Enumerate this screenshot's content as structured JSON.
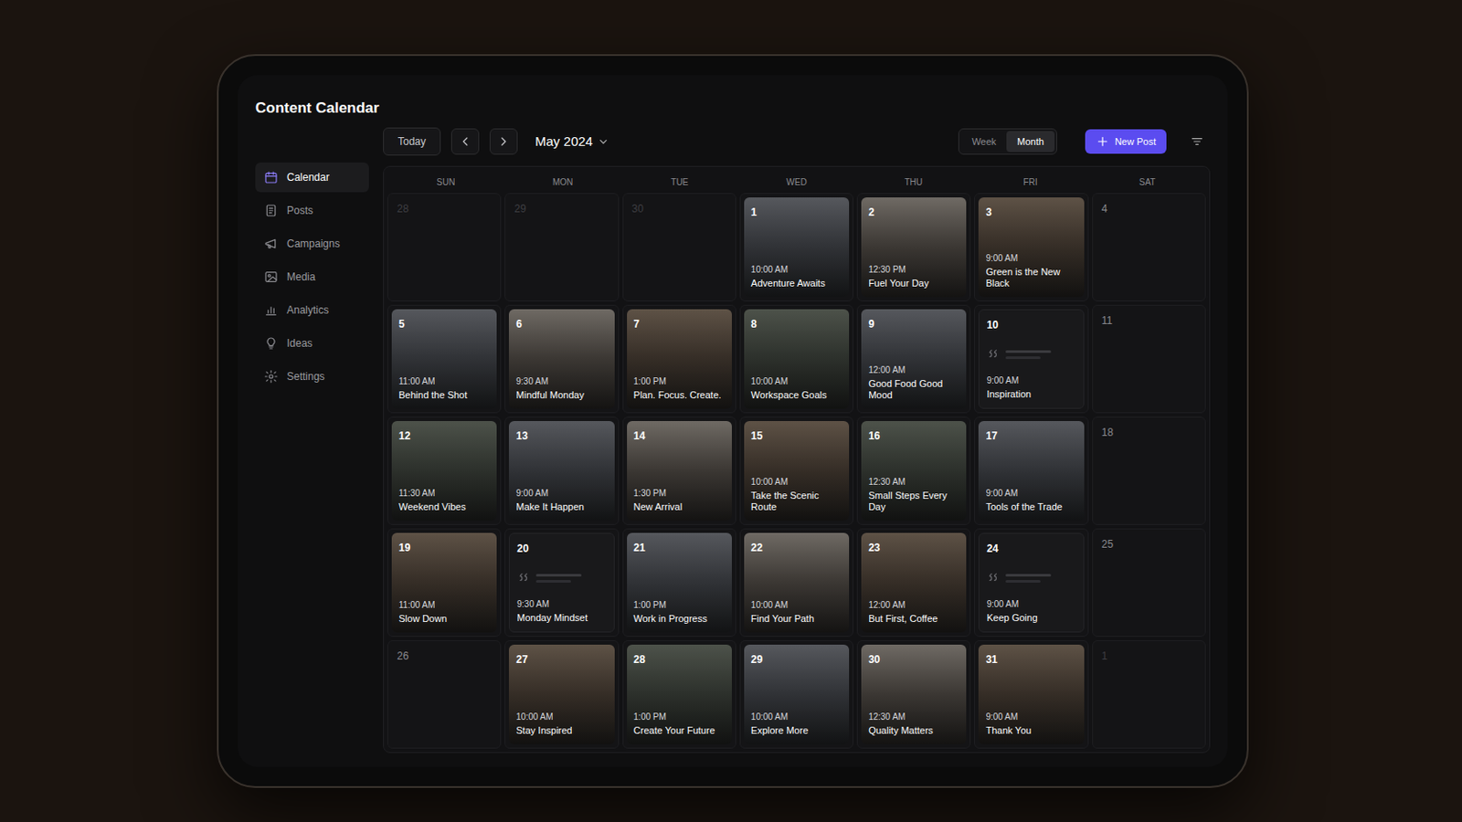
{
  "app": {
    "title": "Content Calendar"
  },
  "sidebar": {
    "items": [
      {
        "label": "Calendar",
        "selected": true
      },
      {
        "label": "Posts",
        "selected": false
      },
      {
        "label": "Campaigns",
        "selected": false
      },
      {
        "label": "Media",
        "selected": false
      },
      {
        "label": "Analytics",
        "selected": false
      },
      {
        "label": "Ideas",
        "selected": false
      },
      {
        "label": "Settings",
        "selected": false
      }
    ]
  },
  "toolbar": {
    "today": "Today",
    "month": "May 2024",
    "views": [
      {
        "label": "Week",
        "selected": false
      },
      {
        "label": "Month",
        "selected": true
      }
    ],
    "new_post": "New Post"
  },
  "calendar": {
    "weekdays": [
      "SUN",
      "MON",
      "TUE",
      "WED",
      "THU",
      "FRI",
      "SAT"
    ],
    "weeks": [
      {
        "days": [
          {
            "date": "28",
            "outside_month": true,
            "kind": "empty"
          },
          {
            "date": "29",
            "outside_month": true,
            "kind": "empty"
          },
          {
            "date": "30",
            "outside_month": true,
            "kind": "empty"
          },
          {
            "date": "1",
            "outside_month": false,
            "kind": "image",
            "time": "10:00 AM",
            "title": "Adventure Awaits"
          },
          {
            "date": "2",
            "outside_month": false,
            "kind": "image",
            "time": "12:30 PM",
            "title": "Fuel Your Day"
          },
          {
            "date": "3",
            "outside_month": false,
            "kind": "image",
            "time": "9:00 AM",
            "title": "Green is the New Black"
          },
          {
            "date": "4",
            "outside_month": false,
            "kind": "empty"
          }
        ]
      },
      {
        "days": [
          {
            "date": "5",
            "outside_month": false,
            "kind": "image",
            "time": "11:00 AM",
            "title": "Behind the Shot"
          },
          {
            "date": "6",
            "outside_month": false,
            "kind": "image",
            "time": "9:30 AM",
            "title": "Mindful Monday"
          },
          {
            "date": "7",
            "outside_month": false,
            "kind": "image",
            "time": "1:00 PM",
            "title": "Plan. Focus. Create."
          },
          {
            "date": "8",
            "outside_month": false,
            "kind": "image",
            "time": "10:00 AM",
            "title": "Workspace Goals"
          },
          {
            "date": "9",
            "outside_month": false,
            "kind": "image",
            "time": "12:00 AM",
            "title": "Good Food Good Mood"
          },
          {
            "date": "10",
            "outside_month": false,
            "kind": "quote",
            "time": "9:00 AM",
            "title": "Inspiration"
          },
          {
            "date": "11",
            "outside_month": false,
            "kind": "empty"
          }
        ]
      },
      {
        "days": [
          {
            "date": "12",
            "outside_month": false,
            "kind": "image",
            "time": "11:30 AM",
            "title": "Weekend Vibes"
          },
          {
            "date": "13",
            "outside_month": false,
            "kind": "image",
            "time": "9:00 AM",
            "title": "Make It Happen"
          },
          {
            "date": "14",
            "outside_month": false,
            "kind": "image",
            "time": "1:30 PM",
            "title": "New Arrival"
          },
          {
            "date": "15",
            "outside_month": false,
            "kind": "image",
            "time": "10:00 AM",
            "title": "Take the Scenic Route"
          },
          {
            "date": "16",
            "outside_month": false,
            "kind": "image",
            "time": "12:30 AM",
            "title": "Small Steps Every Day"
          },
          {
            "date": "17",
            "outside_month": false,
            "kind": "image",
            "time": "9:00 AM",
            "title": "Tools of the Trade"
          },
          {
            "date": "18",
            "outside_month": false,
            "kind": "empty"
          }
        ]
      },
      {
        "days": [
          {
            "date": "19",
            "outside_month": false,
            "kind": "image",
            "time": "11:00 AM",
            "title": "Slow Down"
          },
          {
            "date": "20",
            "outside_month": false,
            "kind": "quote",
            "time": "9:30 AM",
            "title": "Monday Mindset"
          },
          {
            "date": "21",
            "outside_month": false,
            "kind": "image",
            "time": "1:00 PM",
            "title": "Work in Progress"
          },
          {
            "date": "22",
            "outside_month": false,
            "kind": "image",
            "time": "10:00 AM",
            "title": "Find Your Path"
          },
          {
            "date": "23",
            "outside_month": false,
            "kind": "image",
            "time": "12:00 AM",
            "title": "But First, Coffee"
          },
          {
            "date": "24",
            "outside_month": false,
            "kind": "quote",
            "time": "9:00 AM",
            "title": "Keep Going"
          },
          {
            "date": "25",
            "outside_month": false,
            "kind": "empty"
          }
        ]
      },
      {
        "days": [
          {
            "date": "26",
            "outside_month": false,
            "kind": "empty"
          },
          {
            "date": "27",
            "outside_month": false,
            "kind": "image",
            "time": "10:00 AM",
            "title": "Stay Inspired"
          },
          {
            "date": "28",
            "outside_month": false,
            "kind": "image",
            "time": "1:00 PM",
            "title": "Create Your Future"
          },
          {
            "date": "29",
            "outside_month": false,
            "kind": "image",
            "time": "10:00 AM",
            "title": "Explore More"
          },
          {
            "date": "30",
            "outside_month": false,
            "kind": "image",
            "time": "12:30 AM",
            "title": "Quality Matters"
          },
          {
            "date": "31",
            "outside_month": false,
            "kind": "image",
            "time": "9:00 AM",
            "title": "Thank You"
          },
          {
            "date": "1",
            "outside_month": true,
            "kind": "empty"
          }
        ]
      }
    ]
  }
}
